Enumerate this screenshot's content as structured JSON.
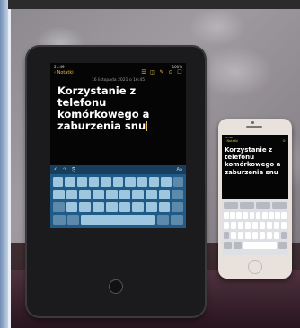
{
  "ipad": {
    "status_time": "21:49",
    "status_battery": "100%",
    "back_label": "Notatki",
    "date_line": "16 listopada 2021 o 16:45",
    "note_title": "Korzystanie z telefonu komórkowego a zaburzenia snu",
    "keyboard_label_aa": "Aa"
  },
  "iphone": {
    "status_time": "21:49",
    "back_label": "Notatki",
    "note_title": "Korzystanie z telefonu komórkowego a zaburzenia snu"
  },
  "colors": {
    "accent": "#e7b84a",
    "ipad_keyboard": "#1f5b86",
    "iphone_keyboard": "#dfe0e4"
  },
  "icons": [
    "chevron-left-icon",
    "checklist-icon",
    "camera-icon",
    "markup-icon",
    "more-icon",
    "compose-icon"
  ]
}
